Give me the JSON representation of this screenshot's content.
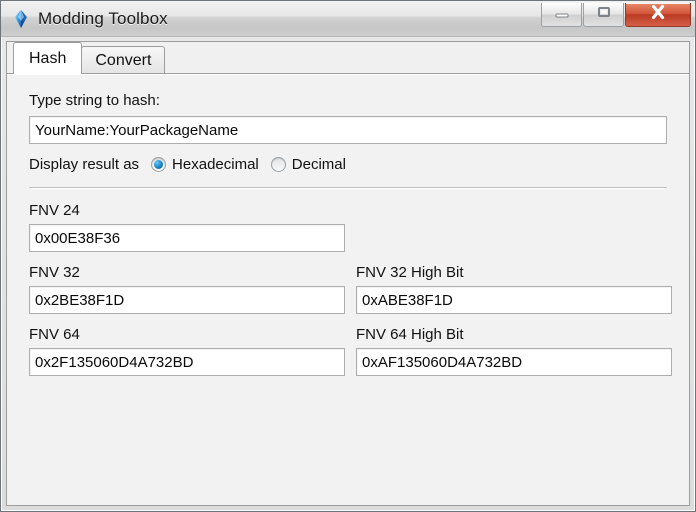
{
  "window": {
    "title": "Modding Toolbox",
    "app_icon": "plumbob-diamond-icon",
    "caption": {
      "minimize_label": "Minimize",
      "maximize_label": "Maximize",
      "close_label": "Close"
    }
  },
  "tabs": [
    {
      "label": "Hash",
      "selected": true
    },
    {
      "label": "Convert",
      "selected": false
    }
  ],
  "hash_tab": {
    "input_label": "Type string to hash:",
    "input_value": "YourName:YourPackageName",
    "input_placeholder": "Type string to hash",
    "display_as": {
      "label": "Display result as",
      "options": [
        {
          "label": "Hexadecimal",
          "selected": true
        },
        {
          "label": "Decimal",
          "selected": false
        }
      ]
    },
    "results": [
      {
        "label": "FNV 24",
        "value": "0x00E38F36",
        "right_label": "",
        "right_value": "",
        "has_right": false
      },
      {
        "label": "FNV 32",
        "value": "0x2BE38F1D",
        "right_label": "FNV 32 High Bit",
        "right_value": "0xABE38F1D",
        "has_right": true
      },
      {
        "label": "FNV 64",
        "value": "0x2F135060D4A732BD",
        "right_label": "FNV 64 High Bit",
        "right_value": "0xAF135060D4A732BD",
        "has_right": true
      }
    ]
  },
  "colors": {
    "close_button": "#c0392b",
    "radio_accent": "#1b8fd0",
    "window_chrome": "#dcdcdc",
    "text": "#111111"
  }
}
